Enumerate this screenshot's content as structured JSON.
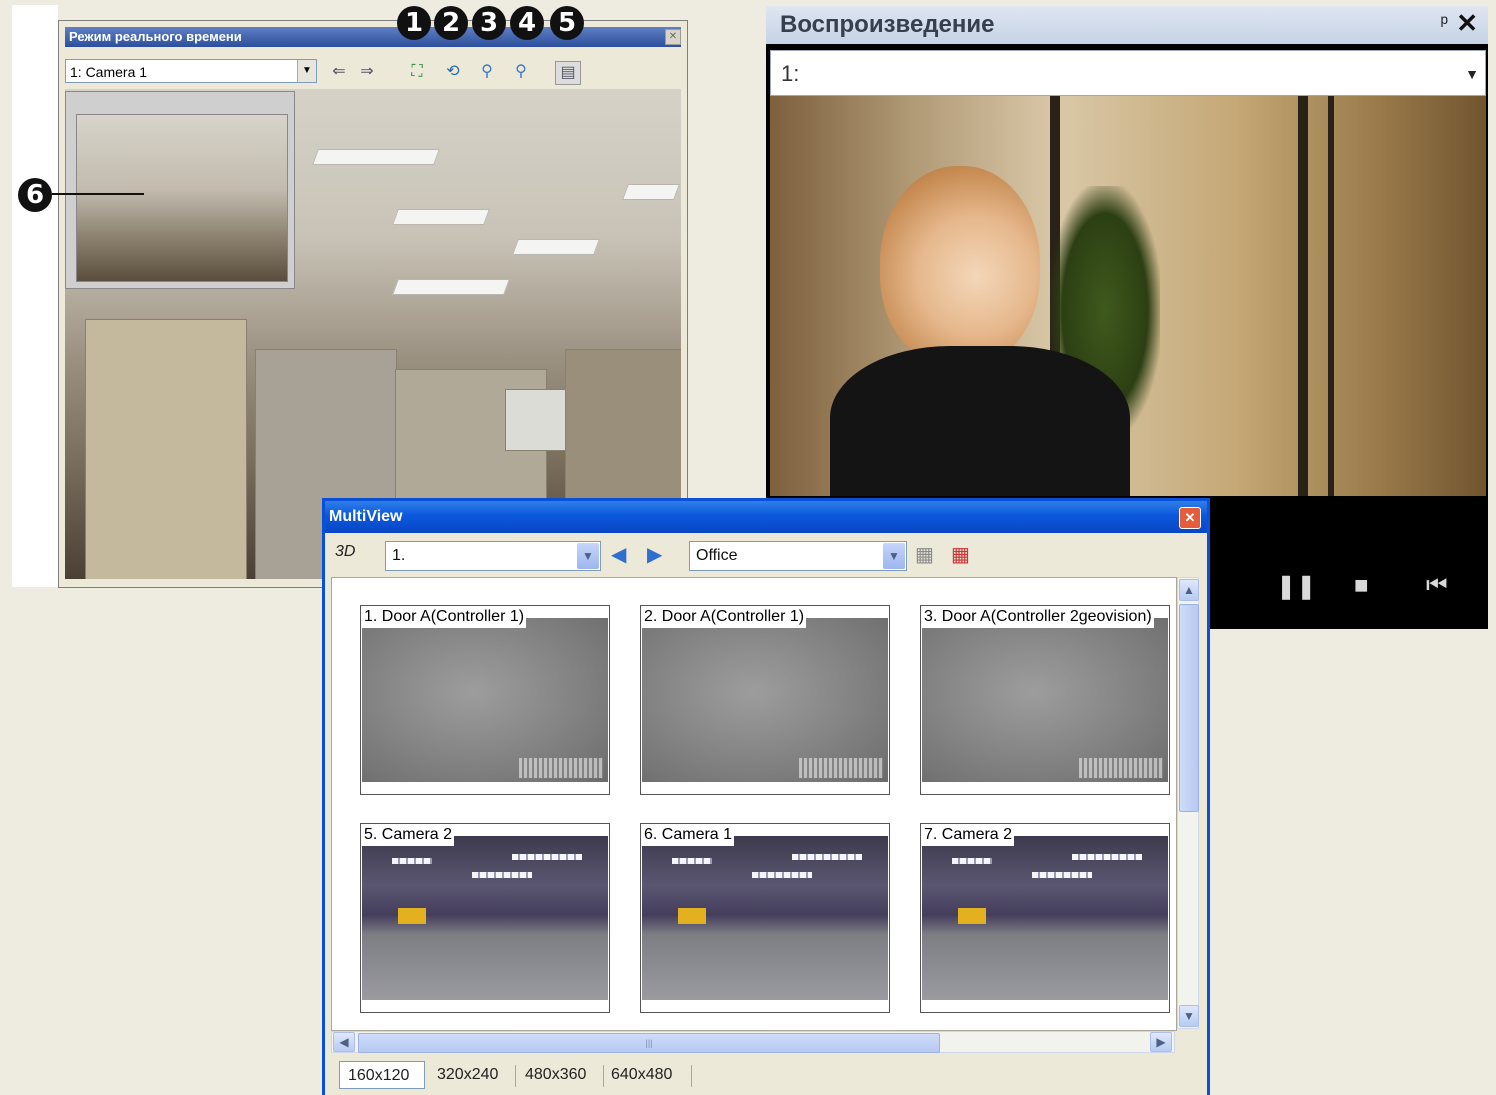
{
  "realtime": {
    "title": "Режим реального времени",
    "camera_select": "1: Camera 1",
    "callouts": [
      "1",
      "2",
      "3",
      "4",
      "5",
      "6"
    ]
  },
  "playback": {
    "title": "Воспроизведение",
    "channel_select": "1:",
    "pin_icon": "pin-icon",
    "close_icon": "close-icon"
  },
  "multiview": {
    "title": "MultiView",
    "toolbar": {
      "mode_label": "3D",
      "view_select": "1.",
      "group_select": "Office"
    },
    "tiles": [
      {
        "label": "1. Door A(Controller 1)",
        "kind": "door"
      },
      {
        "label": "2. Door A(Controller 1)",
        "kind": "door"
      },
      {
        "label": "3. Door A(Controller 2geovision)",
        "kind": "door"
      },
      {
        "label": "5. Camera 2",
        "kind": "office"
      },
      {
        "label": "6. Camera 1",
        "kind": "office"
      },
      {
        "label": "7. Camera 2",
        "kind": "office"
      }
    ],
    "sizes": [
      "160x120",
      "320x240",
      "480x360",
      "640x480"
    ],
    "selected_size": "160x120"
  }
}
